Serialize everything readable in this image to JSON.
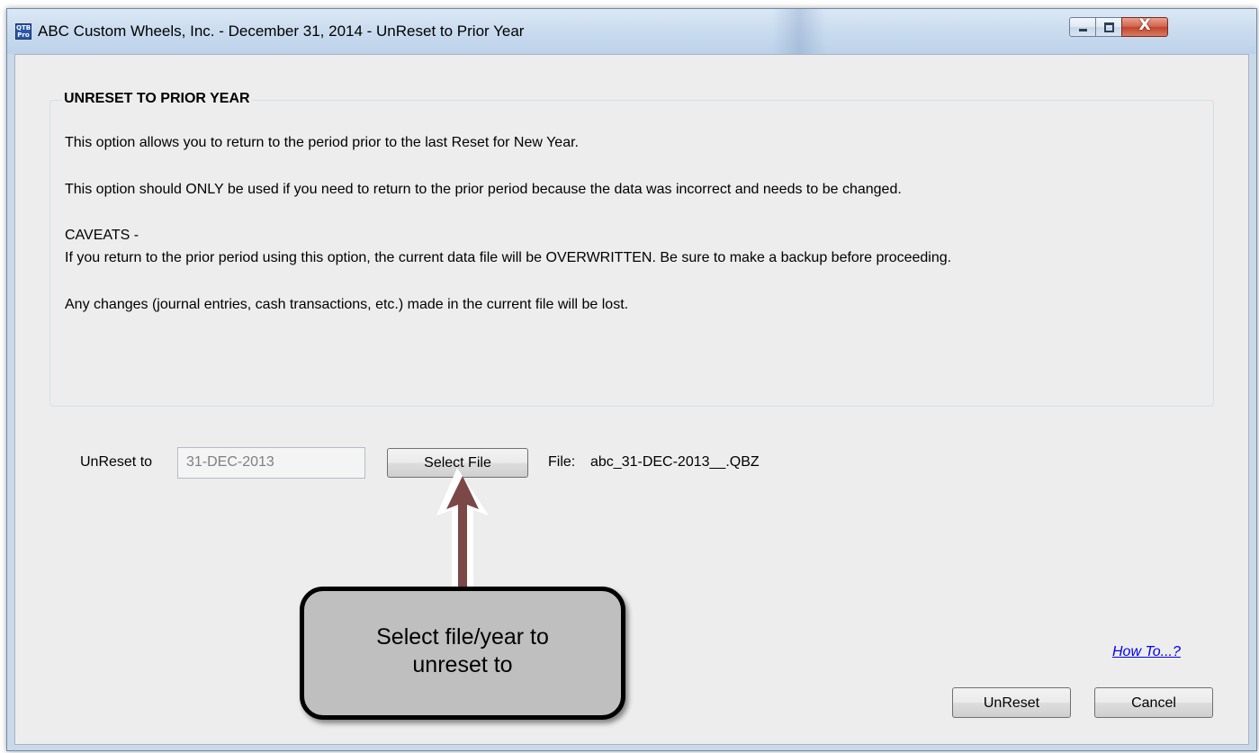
{
  "window": {
    "title": "ABC Custom Wheels, Inc. - December 31, 2014 - UnReset to Prior Year",
    "app_icon_text_top": "QTB",
    "app_icon_text_bottom": "Pro",
    "close_glyph": "X"
  },
  "info": {
    "heading": "UNRESET TO PRIOR YEAR",
    "line1": "This option allows you to return to the period prior to the last Reset for New Year.",
    "line2": "This option should ONLY be used if you need to return to the prior period because the data was incorrect and needs to be changed.",
    "caveats_label": "CAVEATS -",
    "caveats_line1": "If you return to the prior period using this option, the current data file will be OVERWRITTEN.  Be sure to make a backup before proceeding.",
    "caveats_line2": "Any changes (journal entries, cash transactions, etc.) made in the current file will be lost."
  },
  "form": {
    "unreset_label": "UnReset to",
    "unreset_value": "31-DEC-2013",
    "select_file_label": "Select File",
    "file_label": "File:",
    "file_name": "abc_31-DEC-2013__.QBZ"
  },
  "footer": {
    "how_to_link": "How To...?",
    "unreset_button": "UnReset",
    "cancel_button": "Cancel"
  },
  "annotation": {
    "line1": "Select file/year to",
    "line2": "unreset to",
    "arrow_color": "#7b4747",
    "arrow_outline": "#ffffff"
  }
}
